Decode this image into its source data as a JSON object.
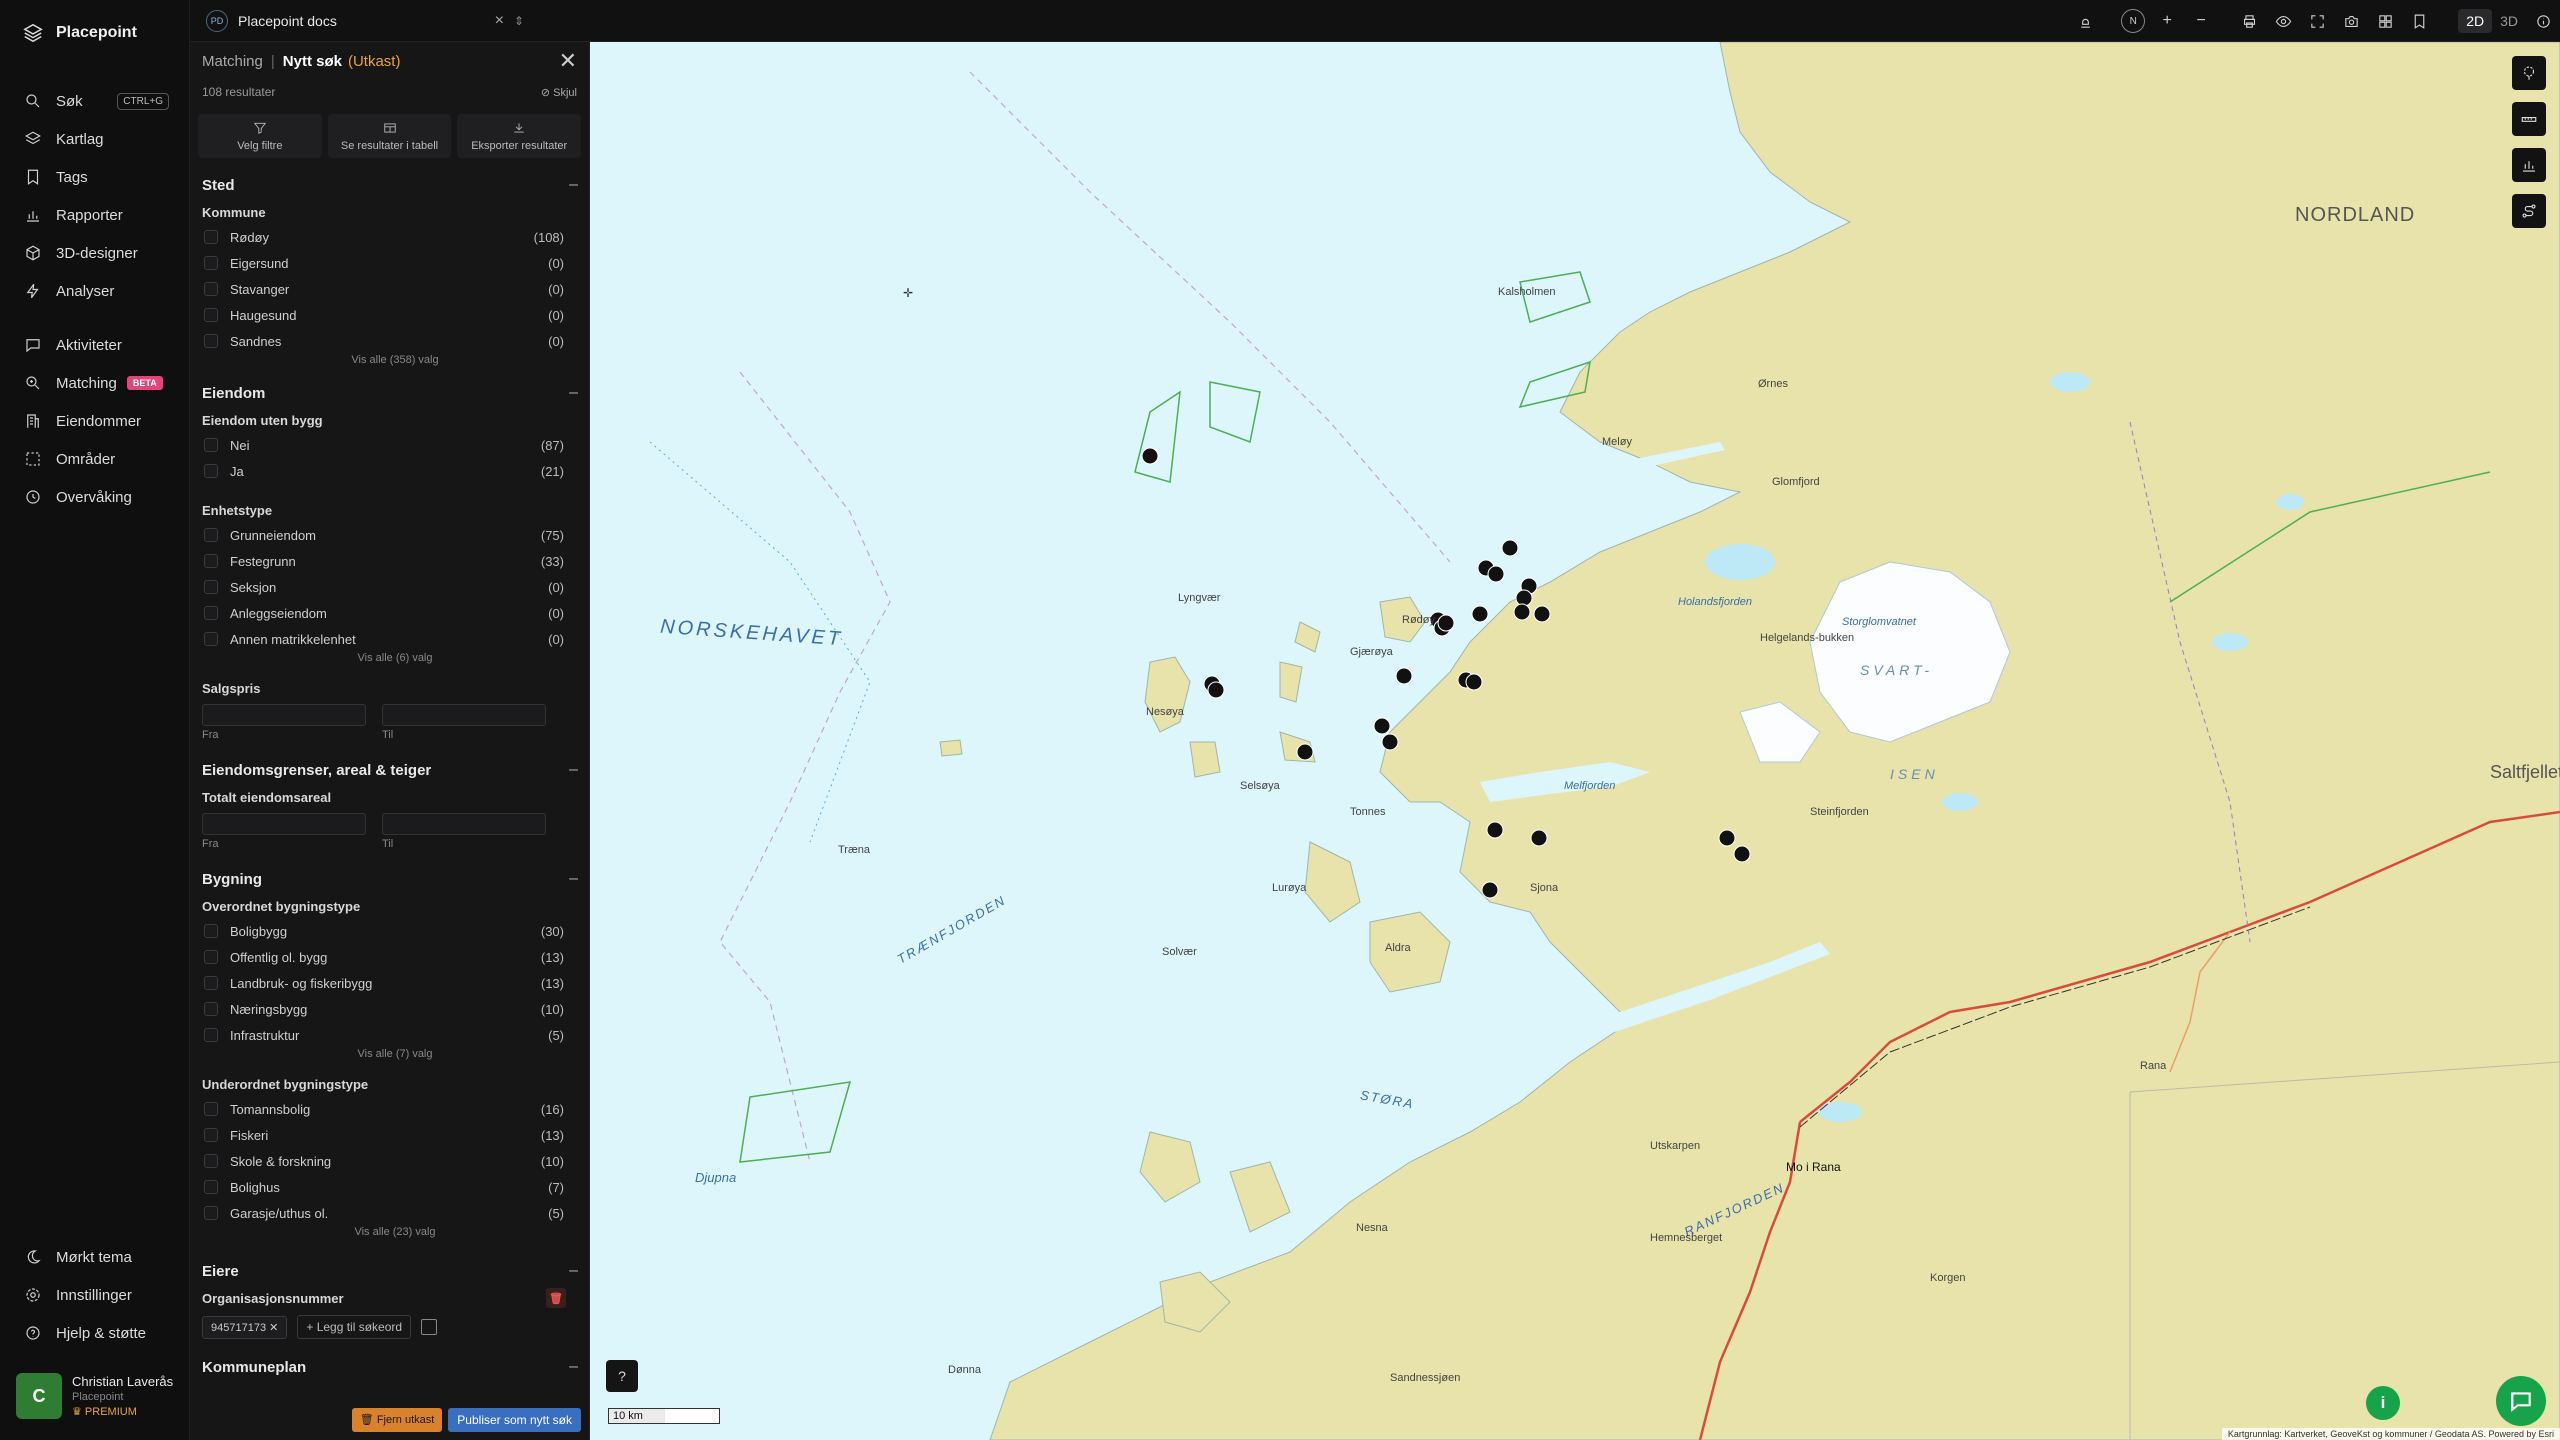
{
  "app": {
    "name": "Placepoint",
    "nav": [
      {
        "label": "Søk",
        "shortcut": "CTRL+G",
        "icon": "search-icon"
      },
      {
        "label": "Kartlag",
        "icon": "layers-icon"
      },
      {
        "label": "Tags",
        "icon": "bookmark-icon"
      },
      {
        "label": "Rapporter",
        "icon": "bar-chart-icon"
      },
      {
        "label": "3D-designer",
        "icon": "cube-icon"
      },
      {
        "label": "Analyser",
        "icon": "bolt-icon"
      },
      {
        "label": "Aktiviteter",
        "icon": "message-icon"
      },
      {
        "label": "Matching",
        "badge": "BETA",
        "icon": "search-plus-icon"
      },
      {
        "label": "Eiendommer",
        "icon": "building-icon"
      },
      {
        "label": "Områder",
        "icon": "dashed-square-icon"
      },
      {
        "label": "Overvåking",
        "icon": "clock-icon"
      }
    ],
    "bottom_nav": [
      {
        "label": "Mørkt tema",
        "icon": "moon-icon"
      },
      {
        "label": "Innstillinger",
        "icon": "gear-icon"
      },
      {
        "label": "Hjelp & støtte",
        "icon": "help-icon"
      }
    ],
    "user": {
      "initial": "C",
      "name": "Christian Laverås",
      "org": "Placepoint",
      "plan": "PREMIUM"
    }
  },
  "topbar": {
    "doc_badge": "PD",
    "doc_title": "Placepoint docs",
    "modes": [
      "2D",
      "3D"
    ],
    "compass": "N"
  },
  "panel": {
    "crumb": "Matching",
    "title": "Nytt søk",
    "status": "(Utkast)",
    "results": "108 resultater",
    "hide": "Skjul",
    "actions": [
      "Velg filtre",
      "Se resultater i tabell",
      "Eksporter resultater"
    ],
    "sections": {
      "sted": {
        "title": "Sted",
        "kommune": "Kommune",
        "options": [
          {
            "label": "Rødøy",
            "count": "(108)"
          },
          {
            "label": "Eigersund",
            "count": "(0)"
          },
          {
            "label": "Stavanger",
            "count": "(0)"
          },
          {
            "label": "Haugesund",
            "count": "(0)"
          },
          {
            "label": "Sandnes",
            "count": "(0)"
          }
        ],
        "more": "Vis alle (358) valg"
      },
      "eiendom": {
        "title": "Eiendom",
        "uten_bygg": "Eiendom uten bygg",
        "uten_bygg_options": [
          {
            "label": "Nei",
            "count": "(87)"
          },
          {
            "label": "Ja",
            "count": "(21)"
          }
        ],
        "enhetstype": "Enhetstype",
        "enhetstype_options": [
          {
            "label": "Grunneiendom",
            "count": "(75)"
          },
          {
            "label": "Festegrunn",
            "count": "(33)"
          },
          {
            "label": "Seksjon",
            "count": "(0)"
          },
          {
            "label": "Anleggseiendom",
            "count": "(0)"
          },
          {
            "label": "Annen matrikkelenhet",
            "count": "(0)"
          }
        ],
        "enhetstype_more": "Vis alle (6) valg",
        "salgspris": "Salgspris",
        "fra": "Fra",
        "til": "Til"
      },
      "grenser": {
        "title": "Eiendomsgrenser, areal & teiger",
        "totalt": "Totalt eiendomsareal",
        "fra": "Fra",
        "til": "Til"
      },
      "bygning": {
        "title": "Bygning",
        "overordnet": "Overordnet bygningstype",
        "overordnet_options": [
          {
            "label": "Boligbygg",
            "count": "(30)"
          },
          {
            "label": "Offentlig ol. bygg",
            "count": "(13)"
          },
          {
            "label": "Landbruk- og fiskeribygg",
            "count": "(13)"
          },
          {
            "label": "Næringsbygg",
            "count": "(10)"
          },
          {
            "label": "Infrastruktur",
            "count": "(5)"
          }
        ],
        "overordnet_more": "Vis alle (7) valg",
        "underordnet": "Underordnet bygningstype",
        "underordnet_options": [
          {
            "label": "Tomannsbolig",
            "count": "(16)"
          },
          {
            "label": "Fiskeri",
            "count": "(13)"
          },
          {
            "label": "Skole & forskning",
            "count": "(10)"
          },
          {
            "label": "Bolighus",
            "count": "(7)"
          },
          {
            "label": "Garasje/uthus ol.",
            "count": "(5)"
          }
        ],
        "underordnet_more": "Vis alle (23) valg"
      },
      "eiere": {
        "title": "Eiere",
        "org_label": "Organisasjonsnummer",
        "org_chip": "945717173",
        "add_keyword": "Legg til søkeord"
      },
      "kommuneplan": {
        "title": "Kommuneplan"
      }
    },
    "footer": {
      "remove": "Fjern utkast",
      "publish": "Publiser som nytt søk"
    }
  },
  "map": {
    "sea_labels": [
      "NORSKEHAVET",
      "TRÆNFJORDEN",
      "Djupna",
      "RANFJORDEN",
      "STØRA"
    ],
    "region_label": "NORDLAND",
    "glacier_label": "SVART-",
    "glacier_label2": "ISEN",
    "place_labels": [
      "Kalsholmen",
      "Træna",
      "Lyngvær",
      "Nesøya",
      "Selsøya",
      "Gjærøya",
      "Rødøy",
      "Tonnes",
      "Melfjorden",
      "Mo i Rana",
      "Lurøya",
      "Solvær",
      "Aldra",
      "Meløy",
      "Ørnes",
      "Glomfjord",
      "Rana",
      "Saltfjellet",
      "Steinfjorden",
      "Storglomvatnet",
      "Holandsfjorden",
      "Helgelands-bukken",
      "Sjonа",
      "Utskarpen",
      "Hemnesberget",
      "Korgen",
      "Sandnessjøen",
      "Nesna",
      "Dønna"
    ],
    "scale": "10 km",
    "attribution": "Kartgrunnlag: Kartverket, GeoveKst og kommuner / Geodata AS. Powered by Esri"
  },
  "colors": {
    "accent_orange": "#e8a33d",
    "publish_blue": "#3a6fc0",
    "beta_pink": "#e0457b",
    "map_sea": "#ddf6fb",
    "map_land": "#e9e2a9",
    "green_button": "#16a34a"
  }
}
